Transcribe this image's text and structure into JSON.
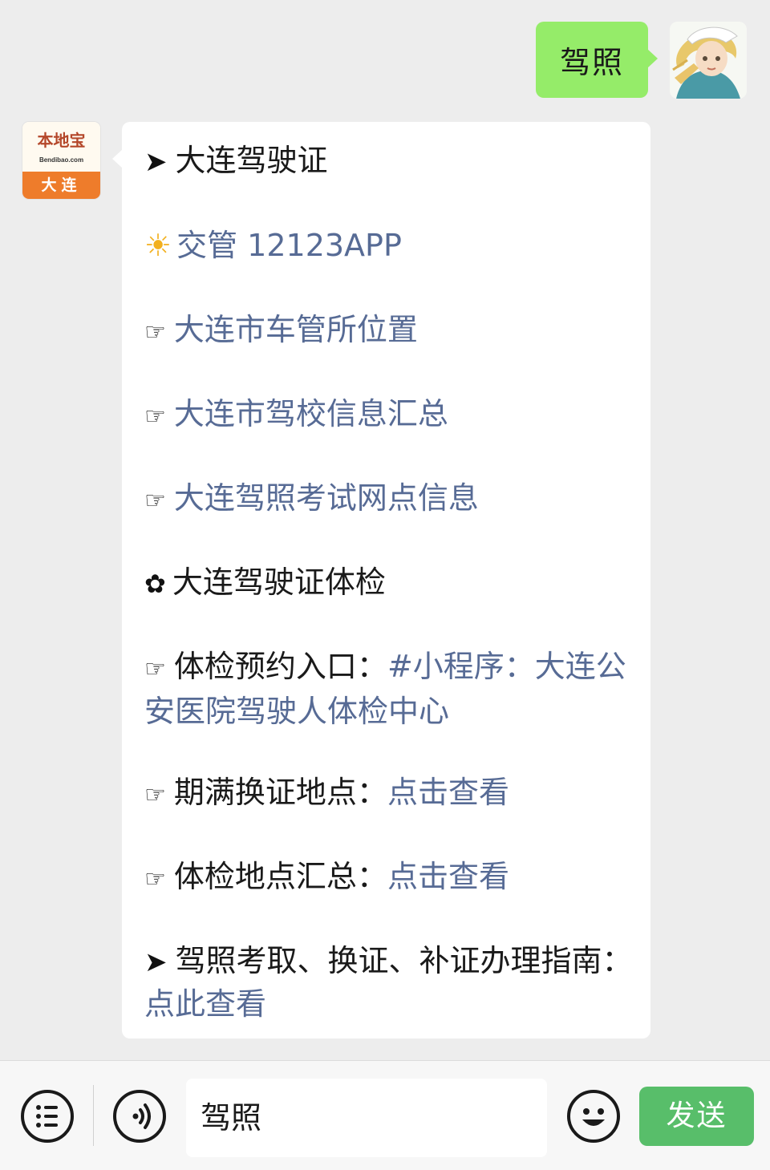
{
  "chat": {
    "sent_message": "驾照",
    "bot": {
      "logo_name": "本地宝",
      "logo_url": "Bendibao.com",
      "logo_city": "大连"
    },
    "reply": {
      "lines": [
        {
          "glyph": "➤",
          "text": "大连驾驶证"
        },
        {
          "glyph": "☀",
          "text": "交管 12123APP"
        },
        {
          "glyph": "☞",
          "text": "大连市车管所位置"
        },
        {
          "glyph": "☞",
          "text": "大连市驾校信息汇总"
        },
        {
          "glyph": "☞",
          "text": "大连驾照考试网点信息"
        },
        {
          "glyph": "✿",
          "text": "大连驾驶证体检"
        },
        {
          "glyph": "☞",
          "label": "体检预约入口",
          "colon": "：",
          "link": "#小程序：大连公安医院驾驶人体检中心"
        },
        {
          "glyph": "☞",
          "label": "期满换证地点",
          "colon": "：",
          "link": "点击查看"
        },
        {
          "glyph": "☞",
          "label": "体检地点汇总",
          "colon": "：",
          "link": "点击查看"
        },
        {
          "glyph": "➤",
          "label": "驾照考取、换证、补证办理指南",
          "colon": "：",
          "link": "点此查看"
        }
      ]
    }
  },
  "input_bar": {
    "input_value": "驾照",
    "send_label": "发送"
  },
  "colors": {
    "background": "#ededed",
    "sent_bubble": "#95ec69",
    "link": "#576b95",
    "send_button": "#58be6a"
  },
  "icons": [
    "menu-icon",
    "voice-icon",
    "emoji-icon",
    "user-avatar",
    "bot-avatar-logo"
  ]
}
